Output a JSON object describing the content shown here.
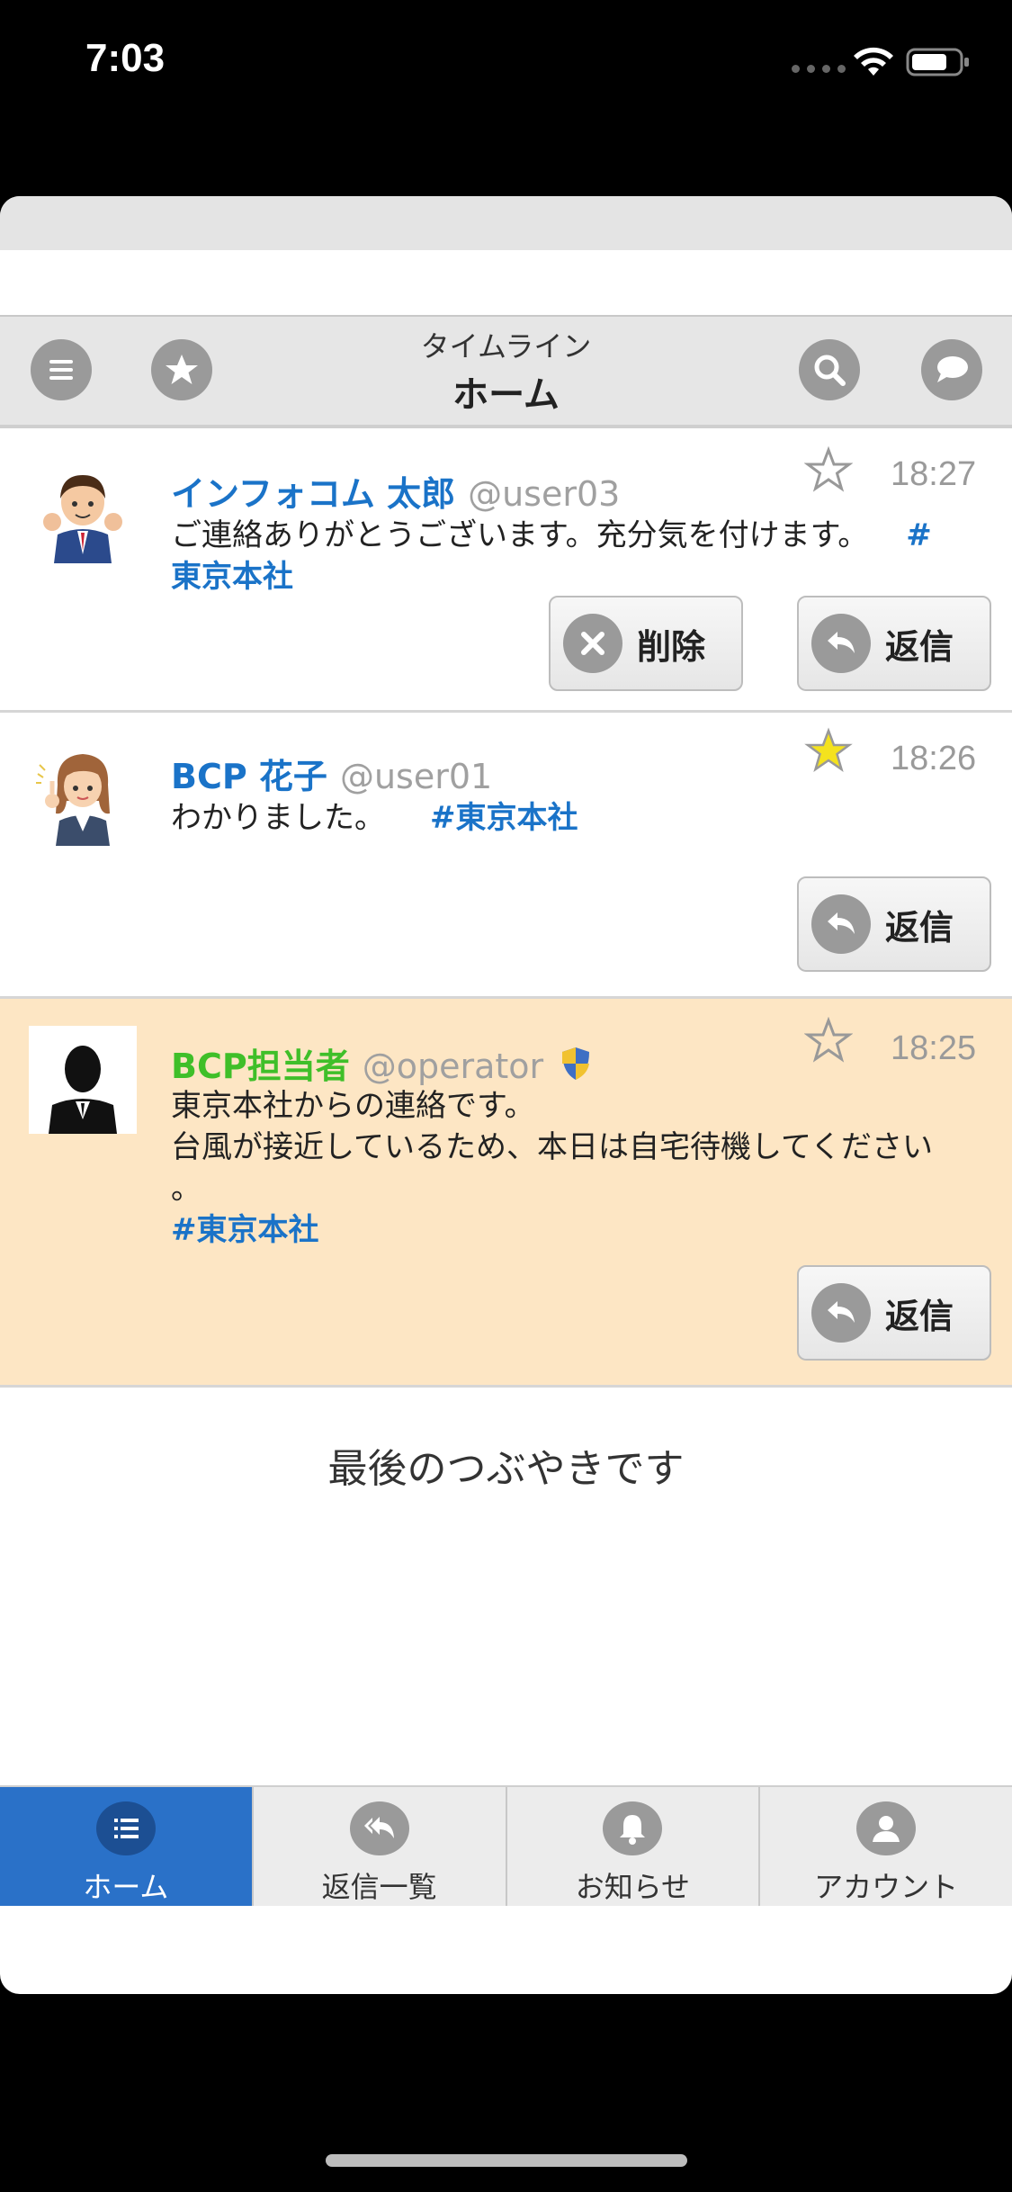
{
  "status_bar": {
    "time": "7:03"
  },
  "header": {
    "subtitle": "タイムライン",
    "title": "ホーム"
  },
  "posts": [
    {
      "name": "インフォコム 太郎",
      "handle": "@user03",
      "time": "18:27",
      "starred": false,
      "body": "ご連絡ありがとうございます。充分気を付けます。",
      "hashtag_wrapped_1": "#",
      "hashtag_wrapped_2": "東京本社",
      "delete_label": "削除",
      "reply_label": "返信"
    },
    {
      "name": "BCP 花子",
      "handle": "@user01",
      "time": "18:26",
      "starred": true,
      "body": "わかりました。",
      "hashtag": "#東京本社",
      "reply_label": "返信"
    },
    {
      "name": "BCP担当者",
      "handle": "@operator",
      "time": "18:25",
      "starred": false,
      "body_line1": "東京本社からの連絡です。",
      "body_line2": "台風が接近しているため、本日は自宅待機してください",
      "body_line3": "。",
      "hashtag": "#東京本社",
      "reply_label": "返信",
      "highlight_color": "#fde6c4"
    }
  ],
  "end_text": "最後のつぶやきです",
  "tabs": [
    {
      "label": "ホーム",
      "icon": "list-icon",
      "active": true
    },
    {
      "label": "返信一覧",
      "icon": "reply-all-icon",
      "active": false
    },
    {
      "label": "お知らせ",
      "icon": "bell-icon",
      "active": false
    },
    {
      "label": "アカウント",
      "icon": "user-icon",
      "active": false
    }
  ],
  "colors": {
    "accent": "#2a71c8",
    "link": "#1a73c8",
    "operator_name": "#3fbf29",
    "star_active": "#f4e21e"
  }
}
